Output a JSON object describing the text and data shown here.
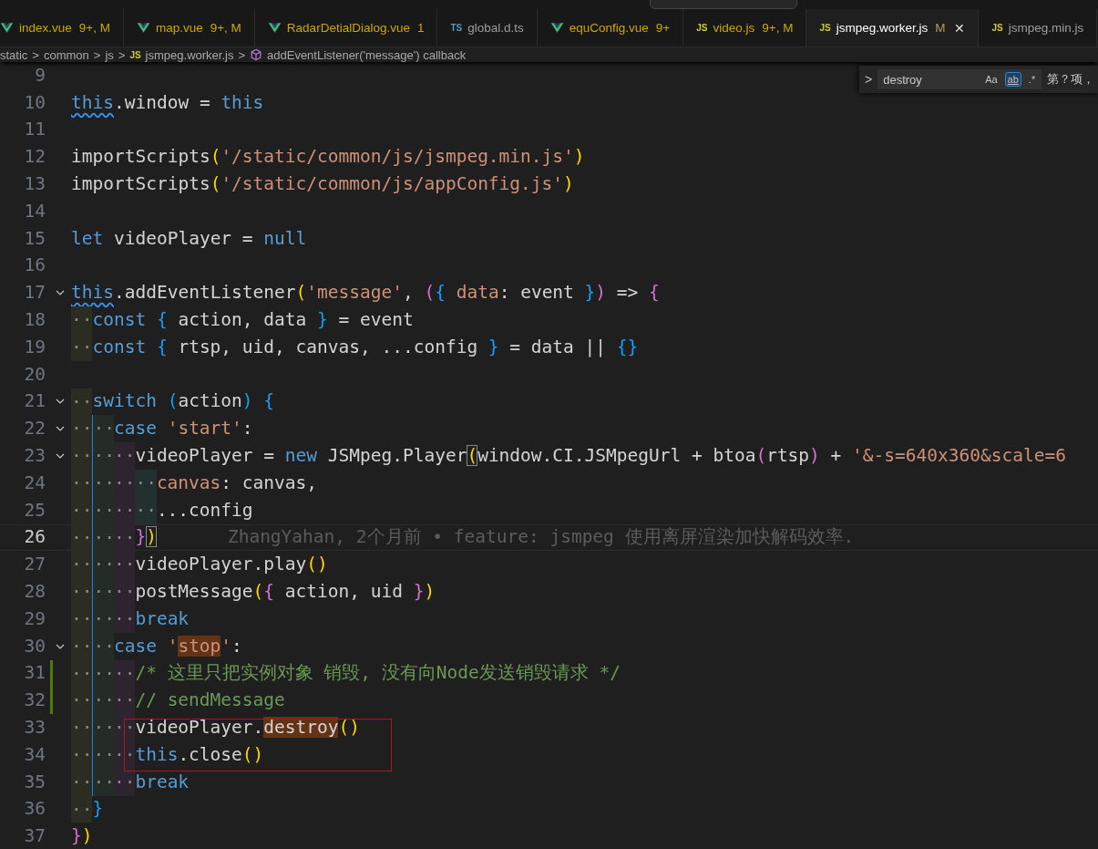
{
  "tabs": [
    {
      "icon": {
        "kind": "vue"
      },
      "label": "index.vue",
      "badge": "9+, M",
      "has_problems": true,
      "selected": false
    },
    {
      "icon": {
        "kind": "vue"
      },
      "label": "map.vue",
      "badge": "9+, M",
      "has_problems": true,
      "selected": false
    },
    {
      "icon": {
        "kind": "vue"
      },
      "label": "RadarDetialDialog.vue",
      "badge": "1",
      "has_problems": true,
      "selected": false
    },
    {
      "icon": {
        "kind": "ts",
        "label": "TS"
      },
      "label": "global.d.ts",
      "has_problems": false,
      "selected": false
    },
    {
      "icon": {
        "kind": "vue"
      },
      "label": "equConfig.vue",
      "badge": "9+",
      "has_problems": true,
      "selected": false
    },
    {
      "icon": {
        "kind": "js",
        "label": "JS"
      },
      "label": "video.js",
      "badge": "9+, M",
      "has_problems": true,
      "selected": false
    },
    {
      "icon": {
        "kind": "js",
        "label": "JS"
      },
      "label": "jsmpeg.worker.js",
      "badge": "M",
      "has_problems": false,
      "selected": true,
      "close_label": "✕"
    },
    {
      "icon": {
        "kind": "js",
        "label": "JS"
      },
      "label": "jsmpeg.min.js",
      "has_problems": false,
      "selected": false
    }
  ],
  "breadcrumbs": [
    {
      "kind": "folder",
      "label": "static"
    },
    {
      "kind": "folder",
      "label": "common"
    },
    {
      "kind": "folder",
      "label": "js"
    },
    {
      "kind": "file",
      "icon_label": "JS",
      "label": "jsmpeg.worker.js"
    },
    {
      "kind": "symbol",
      "label": "addEventListener('message') callback"
    }
  ],
  "breadcrumb_separator": ">",
  "find_widget": {
    "toggle": ">",
    "value": "destroy",
    "options": [
      {
        "label": "Aa",
        "selected": false
      },
      {
        "label": "ab",
        "selected": true
      },
      {
        "label": ".*",
        "selected": false
      }
    ],
    "result": "第？项，"
  },
  "lines": [
    {
      "number": "9"
    },
    {
      "number": "10",
      "tokens": [
        {
          "kind": "kw",
          "t": "this",
          "squiggle": true
        },
        {
          "kind": "pl",
          "t": ".window = "
        },
        {
          "kind": "kw",
          "t": "this"
        }
      ]
    },
    {
      "number": "11"
    },
    {
      "number": "12",
      "tokens": [
        {
          "kind": "pl",
          "t": "importScripts"
        },
        {
          "kind": "b1",
          "t": "("
        },
        {
          "kind": "str",
          "t": "'/static/common/js/jsmpeg.min.js'"
        },
        {
          "kind": "b1",
          "t": ")"
        }
      ]
    },
    {
      "number": "13",
      "tokens": [
        {
          "kind": "pl",
          "t": "importScripts"
        },
        {
          "kind": "b1",
          "t": "("
        },
        {
          "kind": "str",
          "t": "'/static/common/js/appConfig.js'"
        },
        {
          "kind": "b1",
          "t": ")"
        }
      ]
    },
    {
      "number": "14"
    },
    {
      "number": "15",
      "tokens": [
        {
          "kind": "kw",
          "t": "let"
        },
        {
          "kind": "pl",
          "t": " videoPlayer = "
        },
        {
          "kind": "kw",
          "t": "null"
        }
      ]
    },
    {
      "number": "16"
    },
    {
      "number": "17",
      "foldable": true,
      "tokens": [
        {
          "kind": "kw",
          "t": "this",
          "squiggle": true
        },
        {
          "kind": "pl",
          "t": ".addEventListener"
        },
        {
          "kind": "b1",
          "t": "("
        },
        {
          "kind": "str",
          "t": "'message'"
        },
        {
          "kind": "pl",
          "t": ", "
        },
        {
          "kind": "b2",
          "t": "("
        },
        {
          "kind": "b3",
          "t": "{"
        },
        {
          "kind": "str",
          "t": " data"
        },
        {
          "kind": "pl",
          "t": ": event "
        },
        {
          "kind": "b3",
          "t": "}"
        },
        {
          "kind": "b2",
          "t": ")"
        },
        {
          "kind": "pl",
          "t": " => "
        },
        {
          "kind": "b2",
          "t": "{"
        }
      ]
    },
    {
      "number": "18",
      "whitespace": "··",
      "tokens": [
        {
          "kind": "kw",
          "t": "const"
        },
        {
          "kind": "b3",
          "t": " {"
        },
        {
          "kind": "pl",
          "t": " action, data "
        },
        {
          "kind": "b3",
          "t": "}"
        },
        {
          "kind": "pl",
          "t": " = event"
        }
      ]
    },
    {
      "number": "19",
      "whitespace": "··",
      "tokens": [
        {
          "kind": "kw",
          "t": "const"
        },
        {
          "kind": "b3",
          "t": " {"
        },
        {
          "kind": "pl",
          "t": " rtsp, uid, canvas, ...config "
        },
        {
          "kind": "b3",
          "t": "}"
        },
        {
          "kind": "pl",
          "t": " = data || "
        },
        {
          "kind": "b3",
          "t": "{}"
        }
      ]
    },
    {
      "number": "20"
    },
    {
      "number": "21",
      "foldable": true,
      "whitespace": "··",
      "tokens": [
        {
          "kind": "kw",
          "t": "switch"
        },
        {
          "kind": "b3",
          "t": " ("
        },
        {
          "kind": "pl",
          "t": "action"
        },
        {
          "kind": "b3",
          "t": ")"
        },
        {
          "kind": "b3",
          "t": " {"
        }
      ]
    },
    {
      "number": "22",
      "foldable": true,
      "scope": true,
      "whitespace": "····",
      "tokens": [
        {
          "kind": "kw",
          "t": "case"
        },
        {
          "kind": "str",
          "t": " 'start'"
        },
        {
          "kind": "pl",
          "t": ":"
        }
      ]
    },
    {
      "number": "23",
      "foldable": true,
      "scope": true,
      "whitespace": "······",
      "tokens": [
        {
          "kind": "pl",
          "t": "videoPlayer = "
        },
        {
          "kind": "kw",
          "t": "new"
        },
        {
          "kind": "pl",
          "t": " JSMpeg.Player"
        },
        {
          "kind": "b1",
          "t": "(",
          "bracket_match": true
        },
        {
          "kind": "pl",
          "t": "window.CI.JSMpegUrl + btoa"
        },
        {
          "kind": "b2",
          "t": "("
        },
        {
          "kind": "pl",
          "t": "rtsp"
        },
        {
          "kind": "b2",
          "t": ")"
        },
        {
          "kind": "pl",
          "t": " + "
        },
        {
          "kind": "str",
          "t": "'&-s=640x360&scale=6"
        }
      ]
    },
    {
      "number": "24",
      "scope": true,
      "whitespace": "········",
      "tokens": [
        {
          "kind": "str",
          "t": "canvas"
        },
        {
          "kind": "pl",
          "t": ": canvas,"
        }
      ]
    },
    {
      "number": "25",
      "scope": true,
      "whitespace": "········",
      "tokens": [
        {
          "kind": "pl",
          "t": "...config"
        }
      ]
    },
    {
      "number": "26",
      "current": true,
      "scope": true,
      "whitespace": "······",
      "tokens": [
        {
          "kind": "b2",
          "t": "}"
        },
        {
          "kind": "b1",
          "t": ")",
          "bracket_match": true
        }
      ],
      "blame": "ZhangYahan, 2个月前 • feature: jsmpeg 使用离屏渲染加快解码效率."
    },
    {
      "number": "27",
      "scope": true,
      "whitespace": "······",
      "tokens": [
        {
          "kind": "pl",
          "t": "videoPlayer.play"
        },
        {
          "kind": "b1",
          "t": "()"
        }
      ]
    },
    {
      "number": "28",
      "scope": true,
      "whitespace": "······",
      "tokens": [
        {
          "kind": "pl",
          "t": "postMessage"
        },
        {
          "kind": "b1",
          "t": "("
        },
        {
          "kind": "b2",
          "t": "{"
        },
        {
          "kind": "pl",
          "t": " action, uid "
        },
        {
          "kind": "b2",
          "t": "}"
        },
        {
          "kind": "b1",
          "t": ")"
        }
      ]
    },
    {
      "number": "29",
      "scope": true,
      "whitespace": "······",
      "tokens": [
        {
          "kind": "kw",
          "t": "break"
        }
      ]
    },
    {
      "number": "30",
      "foldable": true,
      "scope": true,
      "whitespace": "····",
      "tokens": [
        {
          "kind": "kw",
          "t": "case"
        },
        {
          "kind": "str",
          "t": " '"
        },
        {
          "kind": "str",
          "t": "stop",
          "match": true
        },
        {
          "kind": "str",
          "t": "'"
        },
        {
          "kind": "pl",
          "t": ":"
        }
      ]
    },
    {
      "number": "31",
      "changed": true,
      "scope": true,
      "whitespace": "······",
      "tokens": [
        {
          "kind": "cm",
          "t": "/* 这里只把实例对象 销毁, 没有向Node发送销毁请求 */"
        }
      ]
    },
    {
      "number": "32",
      "changed": true,
      "scope": true,
      "whitespace": "······",
      "tokens": [
        {
          "kind": "cm",
          "t": "// sendMessage"
        }
      ]
    },
    {
      "number": "33",
      "scope": true,
      "whitespace": "······",
      "tokens": [
        {
          "kind": "pl",
          "t": "videoPlayer."
        },
        {
          "kind": "pl",
          "t": "destroy",
          "match": true
        },
        {
          "kind": "b1",
          "t": "()"
        }
      ]
    },
    {
      "number": "34",
      "scope": true,
      "whitespace": "······",
      "tokens": [
        {
          "kind": "kw",
          "t": "this"
        },
        {
          "kind": "pl",
          "t": ".close"
        },
        {
          "kind": "b1",
          "t": "()"
        }
      ]
    },
    {
      "number": "35",
      "scope": true,
      "whitespace": "······",
      "tokens": [
        {
          "kind": "kw",
          "t": "break"
        }
      ]
    },
    {
      "number": "36",
      "whitespace": "··",
      "tokens": [
        {
          "kind": "b3",
          "t": "}"
        }
      ]
    },
    {
      "number": "37",
      "tokens": [
        {
          "kind": "b2",
          "t": "}"
        },
        {
          "kind": "b1",
          "t": ")"
        }
      ]
    }
  ]
}
